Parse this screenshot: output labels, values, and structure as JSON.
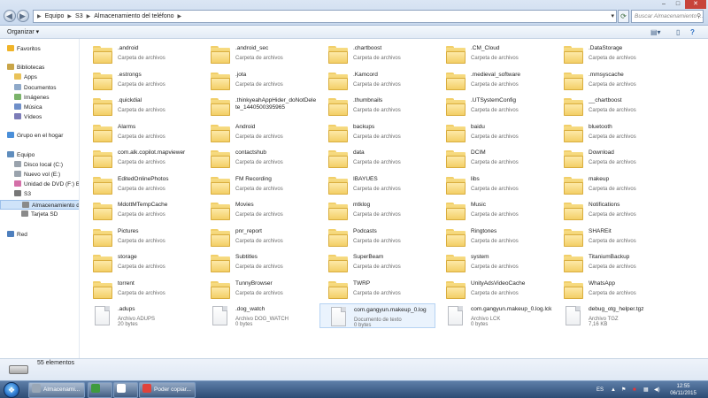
{
  "window": {
    "breadcrumb": [
      "Equipo",
      "S3",
      "Almacenamiento del teléfono"
    ],
    "search_placeholder": "Buscar Almacenamiento ...",
    "controls": [
      "–",
      "□",
      "✕"
    ]
  },
  "toolbar": {
    "organize_label": "Organizar ▾"
  },
  "sidebar": {
    "items": [
      {
        "label": "Favoritos",
        "icon": "star-icon",
        "level": 0
      },
      {
        "label": "Bibliotecas",
        "icon": "library-icon",
        "level": 0
      },
      {
        "label": "Apps",
        "icon": "folder-icon",
        "level": 1
      },
      {
        "label": "Documentos",
        "icon": "documents-icon",
        "level": 1
      },
      {
        "label": "Imágenes",
        "icon": "pictures-icon",
        "level": 1
      },
      {
        "label": "Música",
        "icon": "music-icon",
        "level": 1
      },
      {
        "label": "Vídeos",
        "icon": "videos-icon",
        "level": 1
      },
      {
        "label": "Grupo en el hogar",
        "icon": "homegroup-icon",
        "level": 0
      },
      {
        "label": "Equipo",
        "icon": "computer-icon",
        "level": 0
      },
      {
        "label": "Disco local (C:)",
        "icon": "drive-icon",
        "level": 1
      },
      {
        "label": "Nuevo vol (E:)",
        "icon": "drive-icon",
        "level": 1
      },
      {
        "label": "Unidad de DVD (F:) Bar",
        "icon": "dvd-icon",
        "level": 1
      },
      {
        "label": "S3",
        "icon": "phone-icon",
        "level": 1
      },
      {
        "label": "Almacenamiento del t",
        "icon": "storage-icon",
        "level": 2,
        "selected": true
      },
      {
        "label": "Tarjeta SD",
        "icon": "sdcard-icon",
        "level": 2
      },
      {
        "label": "Red",
        "icon": "network-icon",
        "level": 0
      }
    ]
  },
  "folder_type": "Carpeta de archivos",
  "items": [
    {
      "name": ".android",
      "type": "Carpeta de archivos",
      "kind": "folder"
    },
    {
      "name": ".android_sec",
      "type": "Carpeta de archivos",
      "kind": "folder"
    },
    {
      "name": ".chartboost",
      "type": "Carpeta de archivos",
      "kind": "folder"
    },
    {
      "name": ".CM_Cloud",
      "type": "Carpeta de archivos",
      "kind": "folder"
    },
    {
      "name": ".DataStorage",
      "type": "Carpeta de archivos",
      "kind": "folder"
    },
    {
      "name": ".estrongs",
      "type": "Carpeta de archivos",
      "kind": "folder"
    },
    {
      "name": ".jota",
      "type": "Carpeta de archivos",
      "kind": "folder"
    },
    {
      "name": ".Kamcord",
      "type": "Carpeta de archivos",
      "kind": "folder"
    },
    {
      "name": ".medieval_software",
      "type": "Carpeta de archivos",
      "kind": "folder"
    },
    {
      "name": ".mmsyscache",
      "type": "Carpeta de archivos",
      "kind": "folder"
    },
    {
      "name": ".quickdial",
      "type": "Carpeta de archivos",
      "kind": "folder"
    },
    {
      "name": ".thinkyeahAppHider_doNotDelete_1440500395965",
      "type": "",
      "kind": "folder"
    },
    {
      "name": ".thumbnails",
      "type": "Carpeta de archivos",
      "kind": "folder"
    },
    {
      "name": ".UTSystemConfig",
      "type": "Carpeta de archivos",
      "kind": "folder"
    },
    {
      "name": "__chartboost",
      "type": "Carpeta de archivos",
      "kind": "folder"
    },
    {
      "name": "Alarms",
      "type": "Carpeta de archivos",
      "kind": "folder"
    },
    {
      "name": "Android",
      "type": "Carpeta de archivos",
      "kind": "folder"
    },
    {
      "name": "backups",
      "type": "Carpeta de archivos",
      "kind": "folder"
    },
    {
      "name": "baidu",
      "type": "Carpeta de archivos",
      "kind": "folder"
    },
    {
      "name": "bluetooth",
      "type": "Carpeta de archivos",
      "kind": "folder"
    },
    {
      "name": "com.alk.copilot.mapviewer",
      "type": "Carpeta de archivos",
      "kind": "folder"
    },
    {
      "name": "contactshub",
      "type": "Carpeta de archivos",
      "kind": "folder"
    },
    {
      "name": "data",
      "type": "Carpeta de archivos",
      "kind": "folder"
    },
    {
      "name": "DCIM",
      "type": "Carpeta de archivos",
      "kind": "folder"
    },
    {
      "name": "Download",
      "type": "Carpeta de archivos",
      "kind": "folder"
    },
    {
      "name": "EditedOnlinePhotos",
      "type": "Carpeta de archivos",
      "kind": "folder"
    },
    {
      "name": "FM Recording",
      "type": "Carpeta de archivos",
      "kind": "folder"
    },
    {
      "name": "IBAYUES",
      "type": "Carpeta de archivos",
      "kind": "folder"
    },
    {
      "name": "libs",
      "type": "Carpeta de archivos",
      "kind": "folder"
    },
    {
      "name": "makeup",
      "type": "Carpeta de archivos",
      "kind": "folder"
    },
    {
      "name": "MdottMTempCache",
      "type": "Carpeta de archivos",
      "kind": "folder"
    },
    {
      "name": "Movies",
      "type": "Carpeta de archivos",
      "kind": "folder"
    },
    {
      "name": "mtklog",
      "type": "Carpeta de archivos",
      "kind": "folder"
    },
    {
      "name": "Music",
      "type": "Carpeta de archivos",
      "kind": "folder"
    },
    {
      "name": "Notifications",
      "type": "Carpeta de archivos",
      "kind": "folder"
    },
    {
      "name": "Pictures",
      "type": "Carpeta de archivos",
      "kind": "folder"
    },
    {
      "name": "pnr_report",
      "type": "Carpeta de archivos",
      "kind": "folder"
    },
    {
      "name": "Podcasts",
      "type": "Carpeta de archivos",
      "kind": "folder"
    },
    {
      "name": "Ringtones",
      "type": "Carpeta de archivos",
      "kind": "folder"
    },
    {
      "name": "SHAREit",
      "type": "Carpeta de archivos",
      "kind": "folder"
    },
    {
      "name": "storage",
      "type": "Carpeta de archivos",
      "kind": "folder"
    },
    {
      "name": "Subtitles",
      "type": "Carpeta de archivos",
      "kind": "folder"
    },
    {
      "name": "SuperBeam",
      "type": "Carpeta de archivos",
      "kind": "folder"
    },
    {
      "name": "system",
      "type": "Carpeta de archivos",
      "kind": "folder"
    },
    {
      "name": "TitaniumBackup",
      "type": "Carpeta de archivos",
      "kind": "folder"
    },
    {
      "name": "torrent",
      "type": "Carpeta de archivos",
      "kind": "folder"
    },
    {
      "name": "TunnyBrowser",
      "type": "Carpeta de archivos",
      "kind": "folder"
    },
    {
      "name": "TWRP",
      "type": "Carpeta de archivos",
      "kind": "folder"
    },
    {
      "name": "UnityAdsVideoCache",
      "type": "Carpeta de archivos",
      "kind": "folder"
    },
    {
      "name": "WhatsApp",
      "type": "Carpeta de archivos",
      "kind": "folder"
    },
    {
      "name": ".adups",
      "type": "Archivo ADUPS",
      "size": "20 bytes",
      "kind": "file"
    },
    {
      "name": ".dog_watch",
      "type": "Archivo DOG_WATCH",
      "size": "0 bytes",
      "kind": "file"
    },
    {
      "name": "com.gangyun.makeup_0.log",
      "type": "Documento de texto",
      "size": "0 bytes",
      "kind": "file",
      "selected": true
    },
    {
      "name": "com.gangyun.makeup_0.log.lck",
      "type": "Archivo LCK",
      "size": "0 bytes",
      "kind": "file"
    },
    {
      "name": "debug_otg_helper.tgz",
      "type": "Archivo TGZ",
      "size": "7,16 KB",
      "kind": "file"
    }
  ],
  "status": {
    "count": "55 elementos"
  },
  "taskbar": {
    "buttons": [
      {
        "label": "Almacenami...",
        "icon": "explorer-icon",
        "color": "#9aa7b6",
        "active": true
      },
      {
        "label": "",
        "icon": "xbox-icon",
        "color": "#3f9b3f"
      },
      {
        "label": "",
        "icon": "app-icon",
        "color": "#ffffff"
      },
      {
        "label": "Poder copiar...",
        "icon": "chrome-icon",
        "color": "#e0433b"
      }
    ],
    "language": "ES",
    "time": "12:55",
    "date": "06/11/2015"
  }
}
